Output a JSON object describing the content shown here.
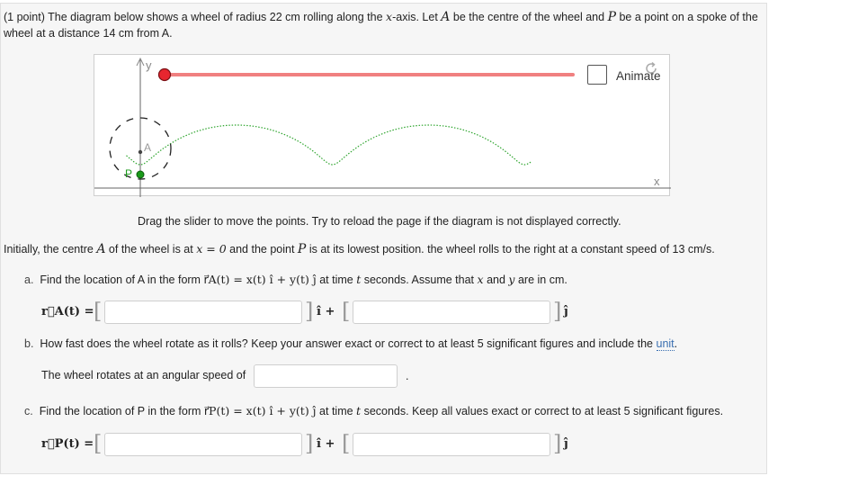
{
  "problem": {
    "points": "(1 point)",
    "intro_a": "The diagram below shows a wheel of radius 22 cm rolling along the",
    "intro_xvar": "x",
    "intro_b": "-axis. Let",
    "intro_A": "A",
    "intro_c": "be the centre of the wheel and",
    "intro_P": "P",
    "intro_d": "be a point on a spoke of the wheel at a distance 14 cm from A."
  },
  "diagram": {
    "y_label": "y",
    "x_label": "x",
    "point_A_label": "A",
    "point_P_label": "P",
    "animate_label": "Animate",
    "slider_color": "#f08080",
    "slider_knob_color": "#e8262f",
    "point_P_color": "#1a9a1a",
    "trajectory_color": "#2fa52f"
  },
  "caption": "Drag the slider to move the points. Try to reload the page if the diagram is not displayed correctly.",
  "initial": {
    "a": "Initially, the centre",
    "A": "A",
    "b": "of the wheel is at",
    "eq": "x = 0",
    "c": "and the point",
    "P": "P",
    "d": "is at its lowest position. the wheel rolls to the right at a constant speed of 13 cm/s."
  },
  "part_a": {
    "letter": "a.",
    "text_a": "Find the location of A in the form",
    "form": "r⃗A(t) = x(t) î + y(t) ĵ",
    "text_b": "at time",
    "t": "t",
    "text_c": "seconds. Assume that",
    "x": "x",
    "and": "and",
    "y": "y",
    "text_d": "are in cm.",
    "lhs": "r⃗A(t) =",
    "i_hat": "î +",
    "j_hat": "ĵ",
    "input_x": "",
    "input_y": ""
  },
  "part_b": {
    "letter": "b.",
    "text_a": "How fast does the wheel rotate as it rolls? Keep your answer exact or correct to at least 5 significant figures and include the",
    "unit_link": "unit",
    "text_b": ".",
    "prompt": "The wheel rotates at an angular speed of",
    "input": "",
    "after": "."
  },
  "part_c": {
    "letter": "c.",
    "text_a": "Find the location of P in the form",
    "form": "r⃗P(t) = x(t) î + y(t) ĵ",
    "text_b": "at time",
    "t": "t",
    "text_c": "seconds. Keep all values exact or correct to at least 5 significant figures.",
    "lhs": "r⃗P(t) =",
    "i_hat": "î +",
    "j_hat": "ĵ",
    "input_x": "",
    "input_y": ""
  }
}
